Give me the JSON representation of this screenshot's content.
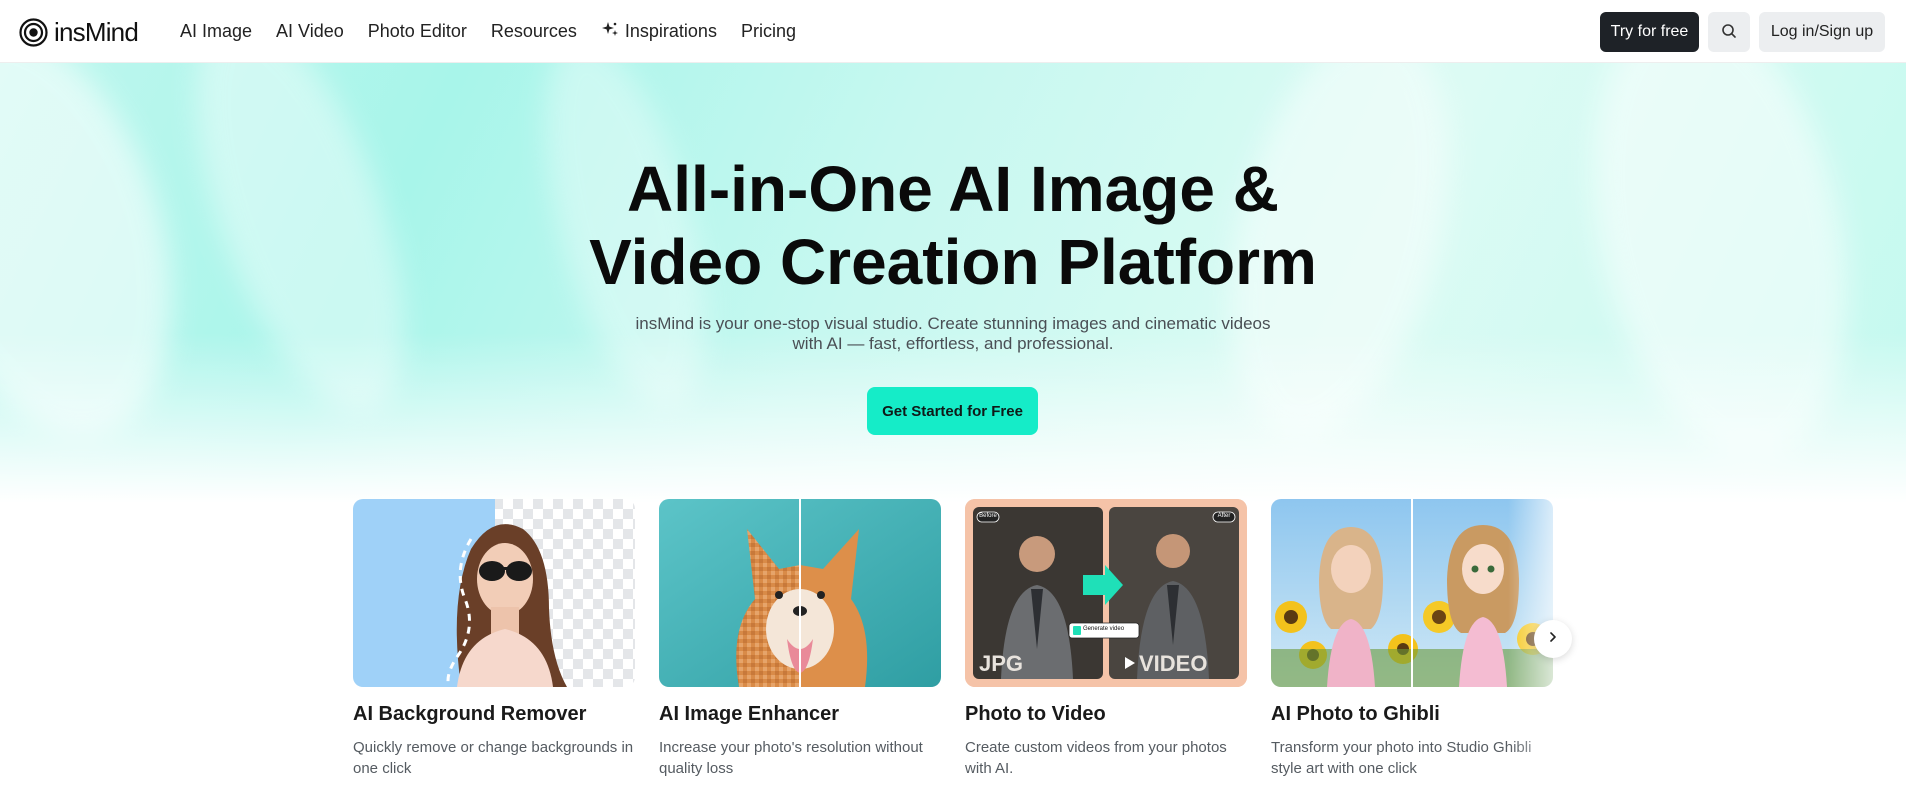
{
  "nav": {
    "logo_text": "insMind",
    "links": [
      "AI Image",
      "AI Video",
      "Photo Editor",
      "Resources",
      "Inspirations",
      "Pricing"
    ],
    "try_label": "Try for free",
    "login_label": "Log in/Sign up"
  },
  "hero": {
    "title_line1": "All-in-One AI Image &",
    "title_line2": "Video Creation Platform",
    "subtitle_line1": "insMind is your one-stop visual studio. Create stunning images and cinematic videos",
    "subtitle_line2": "with AI — fast, effortless, and professional.",
    "cta_label": "Get Started for Free"
  },
  "cards": [
    {
      "title": "AI Background Remover",
      "desc": "Quickly remove or change backgrounds in one click"
    },
    {
      "title": "AI Image Enhancer",
      "desc": "Increase your photo's resolution without quality loss"
    },
    {
      "title": "Photo to Video",
      "desc": "Create custom videos from your photos with AI.",
      "badge_before": "Before",
      "badge_after": "After",
      "generate_label": "Generate video",
      "jpg_label": "JPG",
      "video_label": "VIDEO"
    },
    {
      "title": "AI Photo to Ghibli",
      "desc": "Transform your photo into Studio Ghibli style art with one click"
    }
  ],
  "colors": {
    "accent": "#15ecc8",
    "dark_button": "#1e2227",
    "hero_bg": "#b5f6ec"
  },
  "icons": {
    "search": "search-icon",
    "inspirations": "sparkle-icon",
    "next": "chevron-right-icon"
  }
}
